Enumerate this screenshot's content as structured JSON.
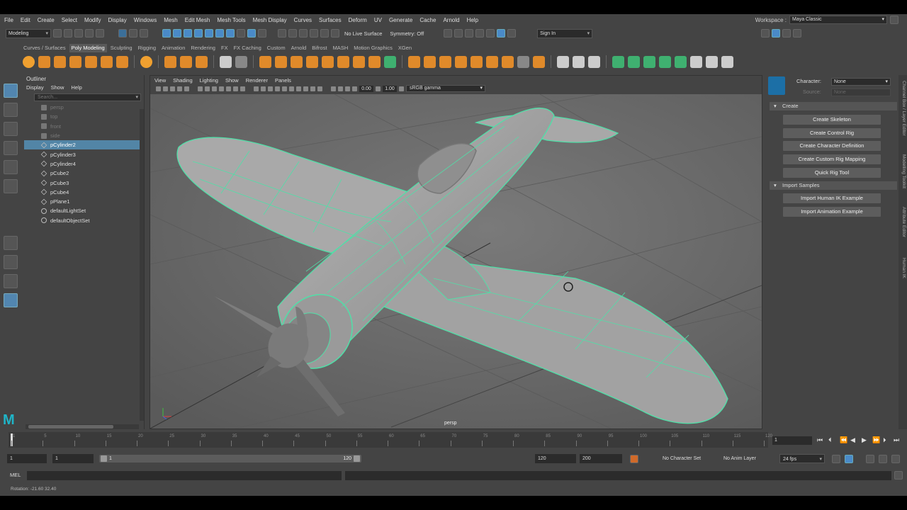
{
  "menubar": {
    "items": [
      "File",
      "Edit",
      "Create",
      "Select",
      "Modify",
      "Display",
      "Windows",
      "Mesh",
      "Edit Mesh",
      "Mesh Tools",
      "Mesh Display",
      "Curves",
      "Surfaces",
      "Deform",
      "UV",
      "Generate",
      "Cache",
      "Arnold",
      "Help"
    ],
    "workspace_label": "Workspace :",
    "workspace_value": "Maya Classic"
  },
  "statusline": {
    "mode": "Modeling",
    "live_surface": "No Live Surface",
    "symmetry": "Symmetry: Off",
    "sign_in": "Sign In"
  },
  "shelf": {
    "tabs": [
      "Curves / Surfaces",
      "Poly Modeling",
      "Sculpting",
      "Rigging",
      "Animation",
      "Rendering",
      "FX",
      "FX Caching",
      "Custom",
      "Arnold",
      "Bifrost",
      "MASH",
      "Motion Graphics",
      "XGen"
    ],
    "active_tab": "Poly Modeling"
  },
  "outliner": {
    "title": "Outliner",
    "menu": [
      "Display",
      "Show",
      "Help"
    ],
    "search_placeholder": "Search...",
    "items": [
      {
        "label": "persp",
        "type": "camera",
        "dim": true
      },
      {
        "label": "top",
        "type": "camera",
        "dim": true
      },
      {
        "label": "front",
        "type": "camera",
        "dim": true
      },
      {
        "label": "side",
        "type": "camera",
        "dim": true
      },
      {
        "label": "pCylinder2",
        "type": "mesh",
        "selected": true
      },
      {
        "label": "pCylinder3",
        "type": "mesh"
      },
      {
        "label": "pCylinder4",
        "type": "mesh"
      },
      {
        "label": "pCube2",
        "type": "mesh"
      },
      {
        "label": "pCube3",
        "type": "mesh"
      },
      {
        "label": "pCube4",
        "type": "mesh"
      },
      {
        "label": "pPlane1",
        "type": "mesh"
      },
      {
        "label": "defaultLightSet",
        "type": "set"
      },
      {
        "label": "defaultObjectSet",
        "type": "set"
      }
    ]
  },
  "viewport": {
    "menu": [
      "View",
      "Shading",
      "Lighting",
      "Show",
      "Renderer",
      "Panels"
    ],
    "exposure": "0.00",
    "gamma": "1.00",
    "color_space": "sRGB gamma",
    "camera_label": "persp",
    "wire_color": "#4fe0a8"
  },
  "humanik": {
    "character_label": "Character:",
    "character_value": "None",
    "source_label": "Source:",
    "source_value": "None",
    "create_section": "Create",
    "create_buttons": [
      "Create Skeleton",
      "Create Control Rig",
      "Create Character Definition",
      "Create Custom Rig Mapping",
      "Quick Rig Tool"
    ],
    "import_section": "Import Samples",
    "import_buttons": [
      "Import Human IK Example",
      "Import Animation Example"
    ]
  },
  "side_tabs": [
    "Channel Box / Layer Editor",
    "Modelling Toolkit",
    "Attribute Editor",
    "Human IK"
  ],
  "timeslider": {
    "ticks": [
      "1",
      "5",
      "10",
      "15",
      "20",
      "25",
      "30",
      "35",
      "40",
      "45",
      "50",
      "55",
      "60",
      "65",
      "70",
      "75",
      "80",
      "85",
      "90",
      "95",
      "100",
      "105",
      "110",
      "115",
      "120"
    ],
    "current_frame": "1"
  },
  "range": {
    "start": "1",
    "inner_start": "1",
    "slider_start": "1",
    "slider_end": "120",
    "end": "120",
    "outer_end": "200",
    "character_set": "No Character Set",
    "anim_layer": "No Anim Layer",
    "fps": "24 fps"
  },
  "cmdline": {
    "label": "MEL"
  },
  "helpline": {
    "text": "Rotation: -21.60    32.40"
  }
}
